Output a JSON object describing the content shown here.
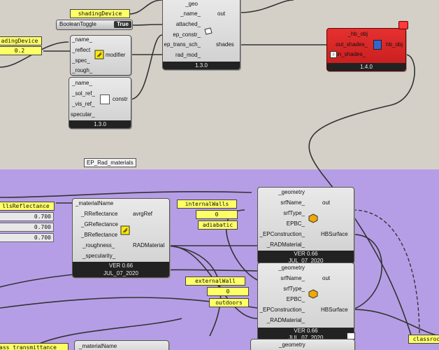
{
  "toolbar_top": {
    "shading_device_label": "shadingDevice",
    "boolean_toggle_label": "BooleanToggle",
    "boolean_toggle_value": "True",
    "left_shading_label": "adingDevice",
    "left_shading_value": "0.2"
  },
  "shading_comp": {
    "pins_in": [
      "_geo",
      "_name_",
      "attached_",
      "ep_constr_",
      "ep_trans_sch_",
      "rad_mod_"
    ],
    "pins_out": [
      "out",
      "shades"
    ],
    "version": "1.3.0"
  },
  "modifier_comp": {
    "pins_in": [
      "_name_",
      "_reflect",
      "_spec_",
      "_rough_"
    ],
    "out": "modifier"
  },
  "constr_comp": {
    "pins_in": [
      "_name_",
      "_sol_ref_",
      "_vis_ref_",
      "specular_"
    ],
    "out": "constr",
    "version": "1.3.0"
  },
  "hb_comp": {
    "pins_in": [
      "_hb_obj",
      "out_shades_",
      "in_shades_"
    ],
    "out": "hb_obj",
    "version": "1.4.0"
  },
  "group": {
    "title": "EP_Rad_materials"
  },
  "rad_material": {
    "left_label": "llsReflectance",
    "sliders": [
      "0.700",
      "0.700",
      "0.700"
    ],
    "pins_in": [
      "_materialName",
      "_RReflectance",
      "_GReflectance",
      "_BReflectance",
      "_roughness_",
      "_specularity_"
    ],
    "pins_out": [
      "avrgRef",
      "RADMaterial"
    ],
    "version": "VER 0.66",
    "date": "JUL_07_2020"
  },
  "hbsurface1": {
    "panels": [
      "internalWalls",
      "0",
      "adiabatic"
    ],
    "pins_in": [
      "_geometry",
      "srfName_",
      "srfType_",
      "EPBC_",
      "_EPConstruction_",
      "_RADMaterial_"
    ],
    "pins_out": [
      "out",
      "HBSurface"
    ],
    "version": "VER 0.66",
    "date": "JUL_07_2020"
  },
  "hbsurface2": {
    "panels": [
      "externalWall",
      "0",
      "outdoors"
    ],
    "pins_in": [
      "_geometry",
      "srfName_",
      "srfType_",
      "EPBC_",
      "_EPConstruction_",
      "_RADMaterial_"
    ],
    "pins_out": [
      "out",
      "HBSurface"
    ],
    "version": "VER 0.66",
    "date": "JUL_07_2020"
  },
  "bottom": {
    "left_label": "ass_transmittance",
    "material_name": "_materialName",
    "geometry": "_geometry",
    "classroom": "classroo"
  },
  "colors": {
    "group": "#b69ee6",
    "canvas": "#d4d0c8",
    "panel": "#ffff66",
    "error": "#dd2222"
  }
}
